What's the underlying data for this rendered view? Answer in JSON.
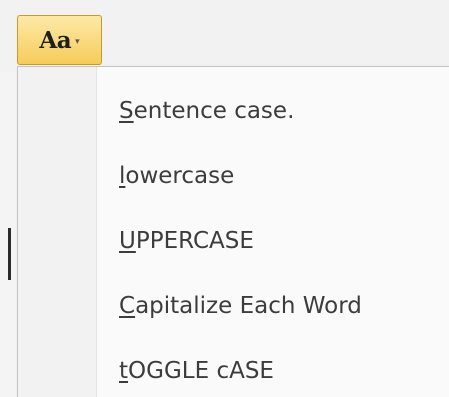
{
  "case_button": {
    "glyph": "Aa",
    "caret": "▾"
  },
  "menu": {
    "items": [
      {
        "mnemonic": "S",
        "rest": "entence case."
      },
      {
        "mnemonic": "l",
        "rest": "owercase"
      },
      {
        "mnemonic": "U",
        "rest": "PPERCASE"
      },
      {
        "mnemonic": "C",
        "rest": "apitalize Each Word"
      },
      {
        "mnemonic": "t",
        "rest": "OGGLE cASE"
      }
    ]
  },
  "colors": {
    "button_fill": "#f6cc5b",
    "button_border": "#c79a2c",
    "menu_text": "#3c3c3c"
  }
}
